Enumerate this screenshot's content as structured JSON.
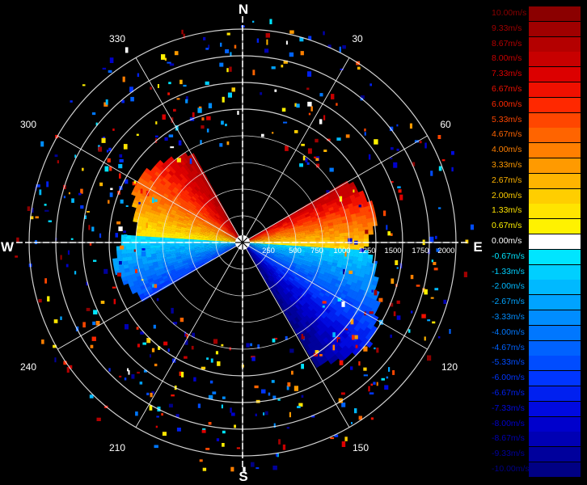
{
  "compass": {
    "north": "N",
    "east": "E",
    "south": "S",
    "west": "W"
  },
  "bearings": [
    "30",
    "60",
    "120",
    "150",
    "210",
    "240",
    "300",
    "330"
  ],
  "range_labels": [
    "250",
    "500",
    "750",
    "1000",
    "1250",
    "1500",
    "1750",
    "2000"
  ],
  "legend": [
    {
      "label": "10.00m/s",
      "color": "#8b0000"
    },
    {
      "label": "9.33m/s",
      "color": "#a00000"
    },
    {
      "label": "8.67m/s",
      "color": "#b40000"
    },
    {
      "label": "8.00m/s",
      "color": "#c80000"
    },
    {
      "label": "7.33m/s",
      "color": "#dc0000"
    },
    {
      "label": "6.67m/s",
      "color": "#f01000"
    },
    {
      "label": "6.00m/s",
      "color": "#ff2800"
    },
    {
      "label": "5.33m/s",
      "color": "#ff4600"
    },
    {
      "label": "4.67m/s",
      "color": "#ff6400"
    },
    {
      "label": "4.00m/s",
      "color": "#ff7f00"
    },
    {
      "label": "3.33m/s",
      "color": "#ff9a00"
    },
    {
      "label": "2.67m/s",
      "color": "#ffb400"
    },
    {
      "label": "2.00m/s",
      "color": "#ffce00"
    },
    {
      "label": "1.33m/s",
      "color": "#ffe400"
    },
    {
      "label": "0.67m/s",
      "color": "#fff200"
    },
    {
      "label": "0.00m/s",
      "color": "#ffffff"
    },
    {
      "label": "-0.67m/s",
      "color": "#00e5ff"
    },
    {
      "label": "-1.33m/s",
      "color": "#00cfff"
    },
    {
      "label": "-2.00m/s",
      "color": "#00b9ff"
    },
    {
      "label": "-2.67m/s",
      "color": "#00a3ff"
    },
    {
      "label": "-3.33m/s",
      "color": "#008dff"
    },
    {
      "label": "-4.00m/s",
      "color": "#0077ff"
    },
    {
      "label": "-4.67m/s",
      "color": "#0062ff"
    },
    {
      "label": "-5.33m/s",
      "color": "#004cff"
    },
    {
      "label": "-6.00m/s",
      "color": "#0036ff"
    },
    {
      "label": "-6.67m/s",
      "color": "#0020f0"
    },
    {
      "label": "-7.33m/s",
      "color": "#000ae0"
    },
    {
      "label": "-8.00m/s",
      "color": "#0000cc"
    },
    {
      "label": "-8.67m/s",
      "color": "#0000b4"
    },
    {
      "label": "-9.33m/s",
      "color": "#00009c"
    },
    {
      "label": "-10.00m/s",
      "color": "#000084"
    }
  ]
}
